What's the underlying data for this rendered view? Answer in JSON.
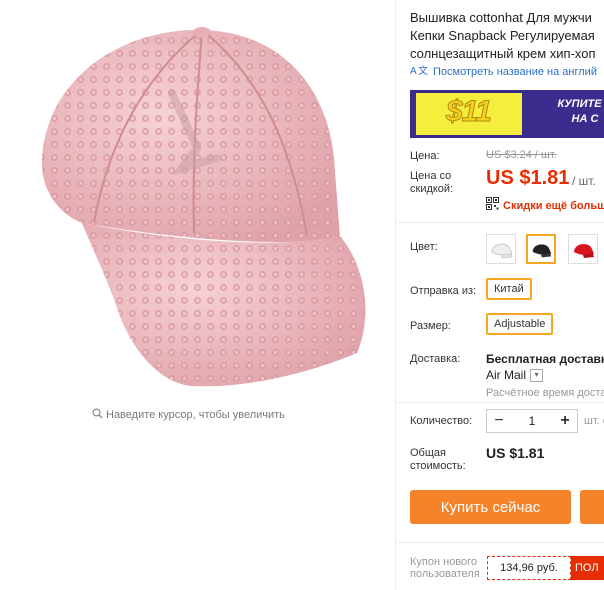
{
  "product": {
    "title_lines": [
      "Вышивка cottonhat Для мужчи",
      "Кепки Snapback Регулируемая",
      "солнцезащитный крем хип-хоп"
    ],
    "translate_link": "Посмотреть название на англий"
  },
  "gallery": {
    "zoom_hint": "Наведите курсор, чтобы увеличить",
    "main_image": "pink-sequin-baseball-cap"
  },
  "banner": {
    "amount": "$11",
    "text_line1": "КУПИТЕ С",
    "text_line2": "НА С"
  },
  "price": {
    "label": "Цена:",
    "old": "US $3.24 / шт.",
    "discount_label": "Цена со скидкой:",
    "current": "US $1.81",
    "unit": "/ шт.",
    "qr_text": "Скидки ещё больше"
  },
  "options": {
    "color_label": "Цвет:",
    "colors": [
      "white",
      "black",
      "red"
    ],
    "selected_color": "black",
    "ship_from_label": "Отправка из:",
    "ship_from_value": "Китай",
    "size_label": "Размер:",
    "size_value": "Adjustable"
  },
  "delivery": {
    "label": "Доставка:",
    "free": "Бесплатная доставка",
    "method": "Air Mail",
    "time": "Расчётное время доста"
  },
  "quantity": {
    "label": "Количество:",
    "minus": "−",
    "value": "1",
    "plus": "+",
    "unit": "шт. с"
  },
  "total": {
    "label": "Общая стоимость:",
    "value": "US $1.81"
  },
  "actions": {
    "buy_now": "Купить сейчас"
  },
  "coupon": {
    "label": "Купон нового пользователя",
    "value": "134,96 руб.",
    "get": "ПОЛ"
  },
  "colors": {
    "accent": "#e62e04",
    "button": "#f5832a",
    "highlight": "#f5a623",
    "link": "#2a70c4"
  }
}
